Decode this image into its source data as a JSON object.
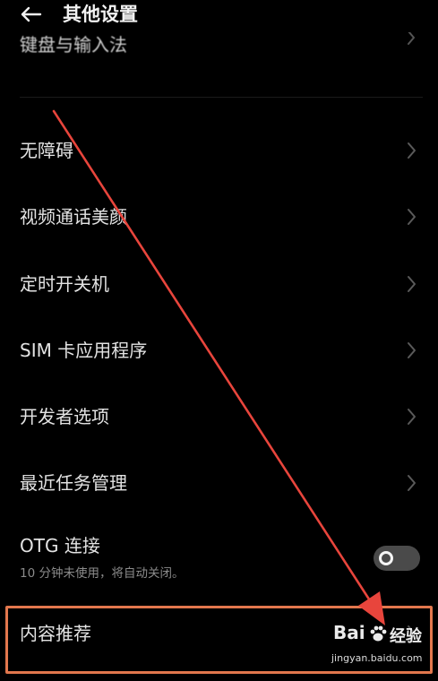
{
  "header": {
    "back_icon": "arrow-left-icon",
    "title": "其他设置"
  },
  "partial_row": {
    "label": "键盘与输入法"
  },
  "rows": [
    {
      "label": "无障碍"
    },
    {
      "label": "视频通话美颜"
    },
    {
      "label": "定时开关机"
    },
    {
      "label": "SIM 卡应用程序"
    },
    {
      "label": "开发者选项"
    },
    {
      "label": "最近任务管理"
    }
  ],
  "otg": {
    "label": "OTG 连接",
    "sublabel": "10 分钟未使用，将自动关闭。",
    "toggle_state": "off"
  },
  "content_recommend": {
    "label": "内容推荐"
  },
  "annotation": {
    "box_color": "#e2774d",
    "arrow_color": "#e8453c"
  },
  "watermark": {
    "brand_a": "Bai",
    "brand_b": "经验",
    "url": "jingyan.baidu.com"
  }
}
